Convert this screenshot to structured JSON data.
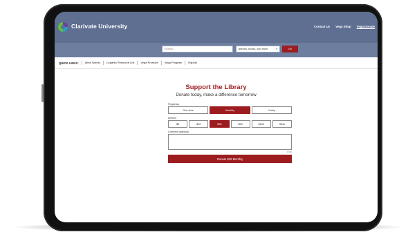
{
  "header": {
    "brand": "Clarivate University",
    "links": [
      "Contact Us",
      "Vega Shop",
      "Vega Donate"
    ]
  },
  "search": {
    "placeholder": "Search...",
    "scope": "articles, books, and more",
    "go_label": "Go"
  },
  "quick_links": {
    "title": "QUICK LINKS:",
    "items": [
      "Alma Specto",
      "Leganto Resource List",
      "Vega Promote",
      "Vega Program",
      "Rapido"
    ]
  },
  "main": {
    "title": "Support the Library",
    "subtitle": "Donate today, make a difference tomorrow"
  },
  "form": {
    "frequency_label": "Frequency",
    "frequency_options": [
      "One-time",
      "Monthly",
      "Yearly"
    ],
    "frequency_selected": "Monthly",
    "amount_label": "Amount",
    "amount_options": [
      "$5",
      "$10",
      "$25",
      "$50",
      "$100",
      "Other"
    ],
    "amount_selected": "$25",
    "comment_label": "Comment (optional)",
    "char_count": "0/100",
    "donate_label": "Donate $25 Monthly"
  },
  "colors": {
    "header_bg": "#5e6f92",
    "search_band_bg": "#6d7e9f",
    "accent": "#9c1c1f"
  }
}
